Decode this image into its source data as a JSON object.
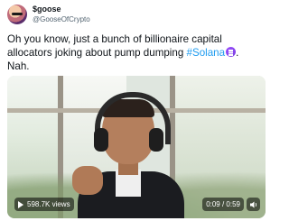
{
  "author": {
    "display_name": "$goose",
    "handle": "@GooseOfCrypto"
  },
  "tweet": {
    "text_part1": "Oh you know, just a bunch of billionaire capital allocators joking about pump dumping ",
    "hashtag": "#Solana",
    "emoji": "solana-logo-emoji",
    "text_part2": ".",
    "text_line3": "Nah."
  },
  "video": {
    "views": "598.7K views",
    "time": "0:09 / 0:59",
    "sound_icon": "speaker-icon"
  },
  "colors": {
    "link": "#1d9bf0",
    "text": "#0f1419",
    "muted": "#536471"
  }
}
